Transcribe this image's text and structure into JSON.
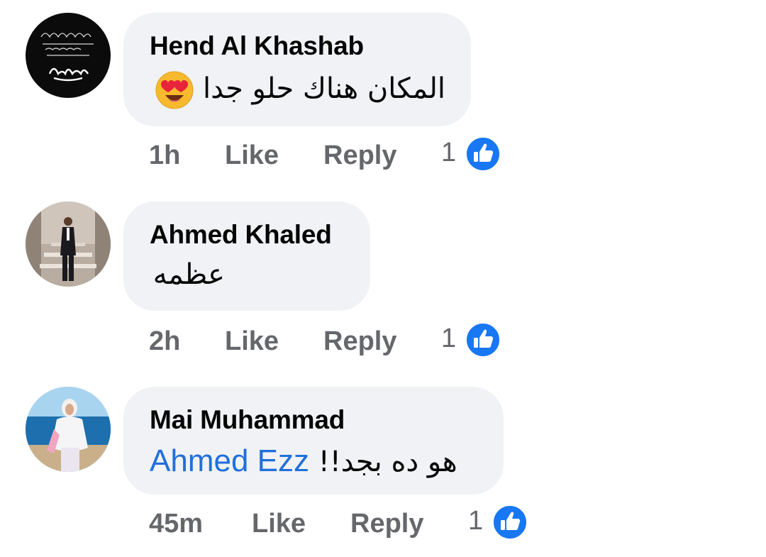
{
  "comments": [
    {
      "author": "Hend Al Khashab",
      "text": "المكان هناك حلو جدا",
      "emoji": "heart-eyes-emoji",
      "time": "1h",
      "like_label": "Like",
      "reply_label": "Reply",
      "reaction_count": "1",
      "reaction_icon": "like-icon"
    },
    {
      "author": "Ahmed Khaled",
      "text": "عظمه",
      "time": "2h",
      "like_label": "Like",
      "reply_label": "Reply",
      "reaction_count": "1",
      "reaction_icon": "like-icon"
    },
    {
      "author": "Mai Muhammad",
      "mention": "Ahmed Ezz",
      "text": "هو ده بجد!!",
      "time": "45m",
      "like_label": "Like",
      "reply_label": "Reply",
      "reaction_count": "1",
      "reaction_icon": "like-icon"
    }
  ],
  "avatar_lettering": {
    "hend": "إنا لله وإنا إليه راجعون — البقاء لله"
  },
  "colors": {
    "bubble": "#f0f2f5",
    "action_text": "#65676b",
    "mention": "#216fdb",
    "like_blue": "#1877f2"
  }
}
